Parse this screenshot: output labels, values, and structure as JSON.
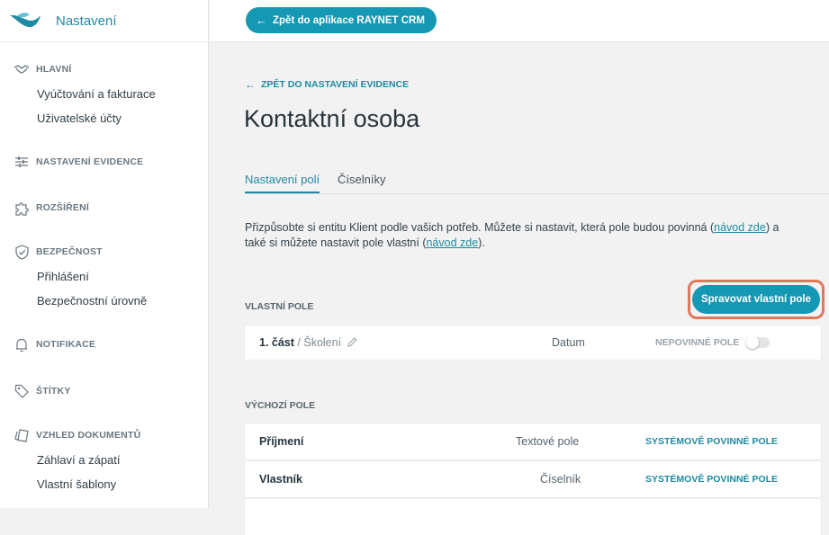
{
  "sidebar": {
    "title": "Nastavení",
    "sections": [
      {
        "label": "HLAVNÍ",
        "icon": "handshake-icon",
        "items": [
          "Vyúčtování a fakturace",
          "Uživatelské účty"
        ]
      },
      {
        "label": "NASTAVENÍ EVIDENCE",
        "icon": "sliders-icon",
        "items": []
      },
      {
        "label": "ROZŠÍŘENÍ",
        "icon": "puzzle-icon",
        "items": []
      },
      {
        "label": "BEZPEČNOST",
        "icon": "shield-icon",
        "items": [
          "Přihlášení",
          "Bezpečnostní úrovně"
        ]
      },
      {
        "label": "NOTIFIKACE",
        "icon": "bell-icon",
        "items": []
      },
      {
        "label": "ŠTÍTKY",
        "icon": "tag-icon",
        "items": []
      },
      {
        "label": "VZHLED DOKUMENTŮ",
        "icon": "documents-icon",
        "items": [
          "Záhlaví a zápatí",
          "Vlastní šablony"
        ]
      }
    ]
  },
  "topbar": {
    "back_button": "Zpět do aplikace RAYNET CRM"
  },
  "main": {
    "back_link": "ZPĚT DO NASTAVENÍ EVIDENCE",
    "title": "Kontaktní osoba",
    "tabs": [
      {
        "label": "Nastavení polí",
        "active": true
      },
      {
        "label": "Číselníky",
        "active": false
      }
    ],
    "description": {
      "part1": "Přizpůsobte si entitu Klient podle vašich potřeb. Můžete si nastavit, která pole budou povinná (",
      "link1": "návod zde",
      "part2": ") a také si můžete nastavit pole vlastní (",
      "link2": "návod zde",
      "part3": ")."
    },
    "custom_section": {
      "label": "VLASTNÍ POLE",
      "manage_button": "Spravovat vlastní pole",
      "rows": [
        {
          "name": "1. část",
          "sub": "/ Školení",
          "type": "Datum",
          "requirement": "NEPOVINNÉ POLE",
          "required": false
        }
      ]
    },
    "default_section": {
      "label": "VÝCHOZÍ POLE",
      "rows": [
        {
          "name": "Příjmení",
          "type": "Textové pole",
          "requirement": "SYSTÉMOVĚ POVINNÉ POLE"
        },
        {
          "name": "Vlastník",
          "type": "Číselník",
          "requirement": "SYSTÉMOVĚ POVINNÉ POLE"
        }
      ]
    }
  },
  "colors": {
    "accent": "#1598b3",
    "highlight": "#e0785c"
  }
}
